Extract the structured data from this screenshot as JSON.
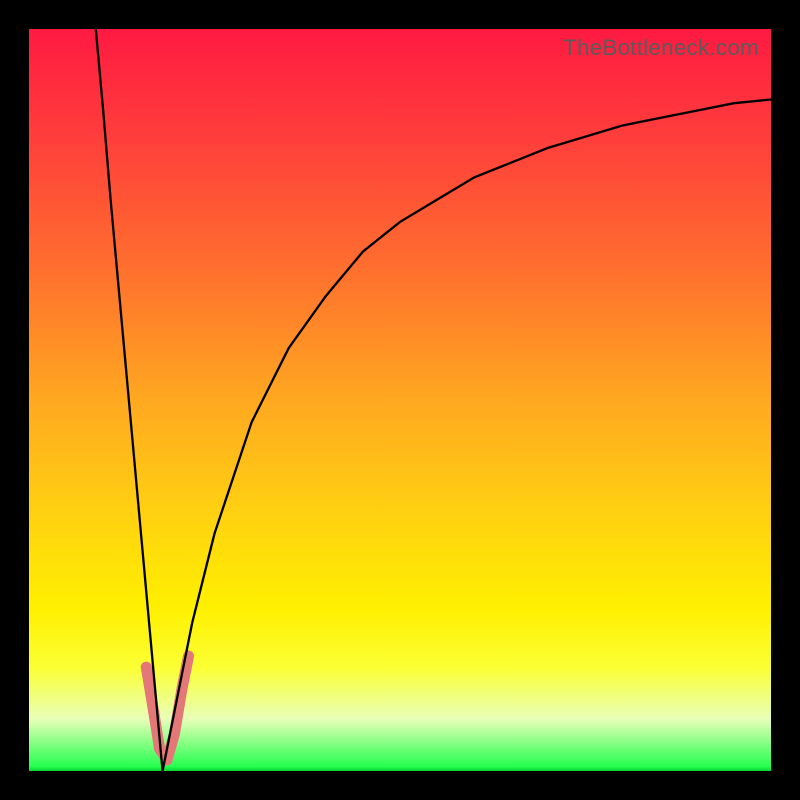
{
  "watermark": "TheBottleneck.com",
  "colors": {
    "frame": "#000000",
    "line": "#000000",
    "marker": "#e47777",
    "gradient_stops": [
      "#ff1a42",
      "#ff3f3b",
      "#ff6e2e",
      "#ffa820",
      "#ffd011",
      "#fff000",
      "#fbff33",
      "#e8ffb8",
      "#26ff50",
      "#07d433"
    ]
  },
  "chart_data": {
    "type": "line",
    "title": "",
    "xlabel": "",
    "ylabel": "",
    "xlim": [
      0,
      100
    ],
    "ylim": [
      0,
      100
    ],
    "grid": false,
    "legend": false,
    "note": "V-shaped bottleneck curve; y-axis inverted visually (0=bottom, 100=top). Minimum at x≈18.",
    "series": [
      {
        "name": "bottleneck-curve-left",
        "x": [
          9,
          10,
          11,
          12,
          13,
          14,
          15,
          16,
          17,
          18
        ],
        "y": [
          100,
          89,
          77,
          66,
          55,
          44,
          33,
          22,
          11,
          0
        ]
      },
      {
        "name": "bottleneck-curve-right",
        "x": [
          18,
          20,
          22,
          25,
          30,
          35,
          40,
          45,
          50,
          55,
          60,
          65,
          70,
          75,
          80,
          85,
          90,
          95,
          100
        ],
        "y": [
          0,
          10,
          20,
          32,
          47,
          57,
          64,
          70,
          74,
          77,
          80,
          82,
          84,
          85.5,
          87,
          88,
          89,
          90,
          90.5
        ]
      }
    ],
    "markers": {
      "name": "emphasis-segments",
      "description": "Short thick salmon segments near the curve's floor",
      "segments": [
        {
          "x1": 15.8,
          "y1": 14,
          "x2": 16.8,
          "y2": 8
        },
        {
          "x1": 16.8,
          "y1": 8,
          "x2": 17.6,
          "y2": 3
        },
        {
          "x1": 17.6,
          "y1": 3,
          "x2": 18.6,
          "y2": 1.5
        },
        {
          "x1": 18.6,
          "y1": 1.5,
          "x2": 19.6,
          "y2": 5
        },
        {
          "x1": 19.6,
          "y1": 5,
          "x2": 20.6,
          "y2": 11
        },
        {
          "x1": 20.6,
          "y1": 11,
          "x2": 21.5,
          "y2": 15.5
        }
      ]
    }
  }
}
